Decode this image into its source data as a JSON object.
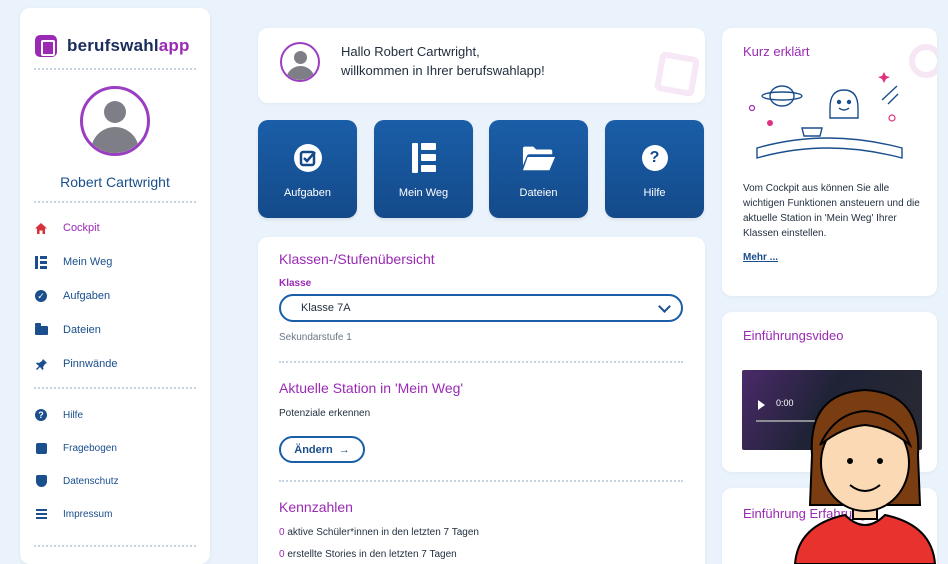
{
  "brand": {
    "prefix": "berufswahl",
    "suffix": "app"
  },
  "user": {
    "name": "Robert Cartwright"
  },
  "sidebar": {
    "items": [
      {
        "label": "Cockpit",
        "icon": "home-icon",
        "active": true
      },
      {
        "label": "Mein Weg",
        "icon": "steps-icon"
      },
      {
        "label": "Aufgaben",
        "icon": "check-circle-icon"
      },
      {
        "label": "Dateien",
        "icon": "folder-icon"
      },
      {
        "label": "Pinnwände",
        "icon": "pin-icon"
      }
    ],
    "secondary": [
      {
        "label": "Hilfe",
        "icon": "help-icon"
      },
      {
        "label": "Fragebogen",
        "icon": "questionnaire-icon"
      },
      {
        "label": "Datenschutz",
        "icon": "shield-icon"
      },
      {
        "label": "Impressum",
        "icon": "impressum-icon"
      }
    ]
  },
  "welcome": {
    "line1": "Hallo Robert Cartwright,",
    "line2": "willkommen in Ihrer berufswahlapp!"
  },
  "tiles": [
    {
      "label": "Aufgaben",
      "icon": "check-circle-icon"
    },
    {
      "label": "Mein Weg",
      "icon": "steps-icon"
    },
    {
      "label": "Dateien",
      "icon": "folder-open-icon"
    },
    {
      "label": "Hilfe",
      "icon": "help-icon"
    }
  ],
  "overview": {
    "title": "Klassen-/Stufenübersicht",
    "class_label": "Klasse",
    "class_value": "Klasse 7A",
    "level": "Sekundarstufe 1",
    "station_title": "Aktuelle Station in 'Mein Weg'",
    "station_value": "Potenziale erkennen",
    "change_button": "Ändern",
    "change_arrow": "→",
    "kpi_title": "Kennzahlen",
    "kpis": [
      {
        "num": "0",
        "text": " aktive Schüler*innen in den letzten 7 Tagen"
      },
      {
        "num": "0",
        "text": " erstellte Stories in den letzten 7 Tagen"
      }
    ]
  },
  "right": {
    "explain_title": "Kurz erklärt",
    "explain_text": "Vom Cockpit aus können Sie alle wichtigen Funktionen ansteuern und die aktuelle Station in 'Mein Weg' Ihrer Klassen einstellen.",
    "explain_link": "Mehr ...",
    "video_title": "Einführungsvideo",
    "video_time": "0:00",
    "video2_title": "Einführung Erfahrung"
  },
  "colors": {
    "accent": "#9a2ab4",
    "primary": "#144a8a",
    "background": "#eaf3fb"
  }
}
